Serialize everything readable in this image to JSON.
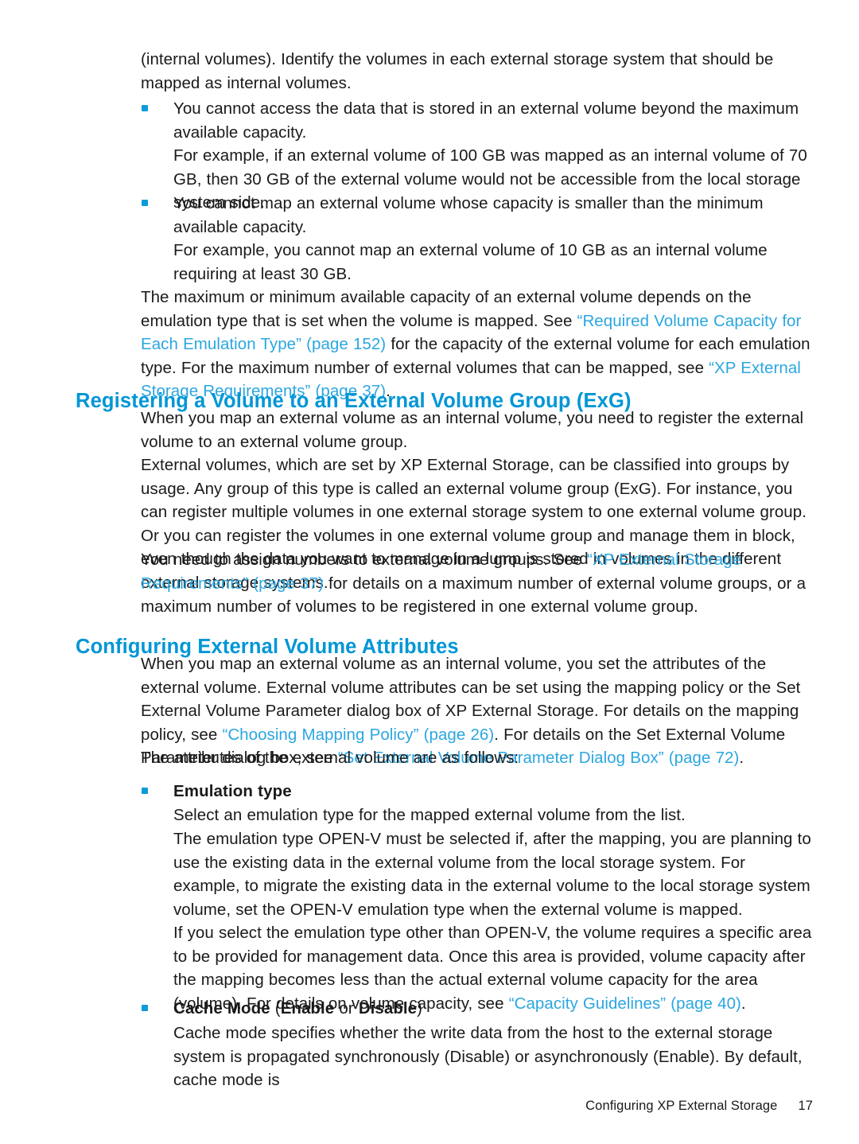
{
  "document": {
    "footer": {
      "section_title": "Configuring XP External Storage",
      "page_number": "17"
    }
  },
  "content": {
    "intro_paragraph": "(internal volumes). Identify the volumes in each external storage system that should be mapped as internal volumes.",
    "bullet_1": "You cannot access the data that is stored in an external volume beyond the maximum available capacity.",
    "bullet_1_example": "For example, if an external volume of 100 GB was mapped as an internal volume of 70 GB, then 30 GB of the external volume would not be accessible from the local storage system side.",
    "bullet_2": "You cannot map an external volume whose capacity is smaller than the minimum available capacity.",
    "bullet_2_example": "For example, you cannot map an external volume of 10 GB as an internal volume requiring at least 30 GB.",
    "emulation_capacity_paragraph": {
      "part_1": "The maximum or minimum available capacity of an external volume depends on the emulation type that is set when the volume is mapped. See ",
      "link_1": "“Required Volume Capacity for Each Emulation Type” (page 152)",
      "part_2": " for the capacity of the external volume for each emulation type. For the maximum number of external volumes that can be mapped, see ",
      "link_2": "“XP External Storage Requirements” (page 37)",
      "part_3": "."
    }
  },
  "section_registering": {
    "heading": "Registering a Volume to an External Volume Group (ExG)",
    "paragraph_1": "When you map an external volume as an internal volume, you need to register the external volume to an external volume group.",
    "paragraph_2": "External volumes, which are set by XP External Storage, can be classified into groups by usage. Any group of this type is called an external volume group (ExG). For instance, you can register multiple volumes in one external storage system to one external volume group. Or you can register the volumes in one external volume group and manage them in block, even though the data you want to manage in a lump is stored in volumes in the different external storage systems.",
    "paragraph_3": {
      "part_1": "You need to assign numbers to external volume groups. See ",
      "link_1": "“XP External Storage Requirements” (page 37)",
      "part_2": " for details on a maximum number of external volume groups, or a maximum number of volumes to be registered in one external volume group."
    }
  },
  "section_configuring": {
    "heading": "Configuring External Volume Attributes",
    "paragraph_1": {
      "part_1": "When you map an external volume as an internal volume, you set the attributes of the external volume. External volume attributes can be set using the mapping policy or the Set External Volume Parameter dialog box of XP External Storage. For details on the mapping policy, see ",
      "link_1": "“Choosing Mapping Policy” (page 26)",
      "part_2": ". For details on the Set External Volume Parameter dialog box, see ",
      "link_2": "“Set External Volume Parameter Dialog Box” (page 72)",
      "part_3": "."
    },
    "paragraph_2": "The attributes of the external volume are as follows:",
    "attributes": [
      {
        "label": "Emulation type",
        "label_parts": null,
        "paragraph_1": "Select an emulation type for the mapped external volume from the list.",
        "paragraph_2": "The emulation type OPEN-V must be selected if, after the mapping, you are planning to use the existing data in the external volume from the local storage system. For example, to migrate the existing data in the external volume to the local storage system volume, set the OPEN-V emulation type when the external volume is mapped.",
        "paragraph_3": {
          "part_1": "If you select the emulation type other than OPEN-V, the volume requires a specific area to be provided for management data. Once this area is provided, volume capacity after the mapping becomes less than the actual external volume capacity for the area (volume). For details on volume capacity, see ",
          "link_1": "“Capacity Guidelines” (page 40)",
          "part_2": "."
        }
      },
      {
        "label": "Cache Mode (Enable or Disable)",
        "label_parts": {
          "bold_1": "Cache Mode ",
          "regular_1": "(",
          "bold_2": "Enable",
          "regular_2": " or ",
          "bold_3": "Disable",
          "regular_3": ")"
        },
        "paragraph_1": "Cache mode specifies whether the write data from the host to the external storage system is propagated synchronously (Disable) or asynchronously (Enable). By default, cache mode is",
        "paragraph_2": null,
        "paragraph_3": null
      }
    ]
  },
  "colors": {
    "heading_blue": "#0096d6",
    "link_blue": "#2ba6e0",
    "bullet_blue": "#0b9bd8",
    "text_black": "#1a1a1a"
  }
}
